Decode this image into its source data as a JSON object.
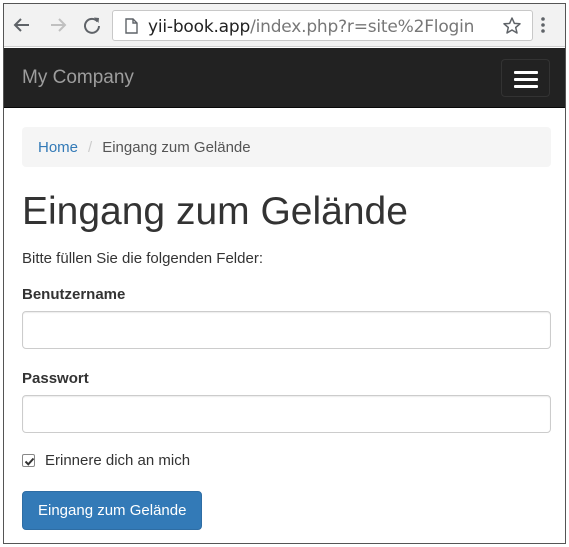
{
  "browser": {
    "url_host": "yii-book.app",
    "url_path": "/index.php?r=site%2Flogin",
    "icons": [
      "back-arrow-icon",
      "forward-arrow-icon",
      "reload-icon",
      "page-icon",
      "star-icon",
      "menu-dots-icon"
    ]
  },
  "navbar": {
    "brand": "My Company",
    "background": "#222222",
    "toggle_icon": "hamburger-menu-icon"
  },
  "breadcrumb": {
    "home": "Home",
    "separator": "/",
    "current": "Eingang zum Gelände"
  },
  "page": {
    "title": "Eingang zum Gelände",
    "intro": "Bitte füllen Sie die folgenden Felder:"
  },
  "form": {
    "username_label": "Benutzername",
    "username_value": "",
    "password_label": "Passwort",
    "password_value": "",
    "remember_label": "Erinnere dich an mich",
    "remember_checked": true,
    "submit_label": "Eingang zum Gelände",
    "submit_color": "#337ab7"
  }
}
